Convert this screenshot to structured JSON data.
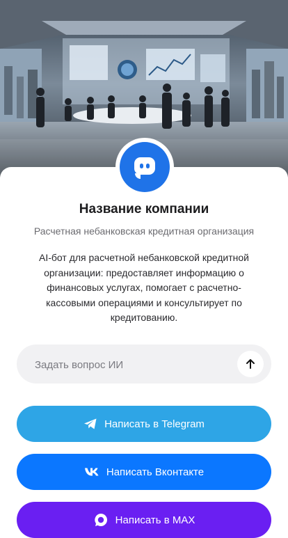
{
  "company": {
    "name": "Название компании",
    "subtitle": "Расчетная небанковская кредитная организация",
    "description": "AI-бот для расчетной небанковской кредитной организации: предоставляет информацию о финансовых услугах, помогает с расчетно-кассовыми операциями и консультирует по кредитованию."
  },
  "ask": {
    "placeholder": "Задать вопрос ИИ",
    "send_icon": "arrow-up-icon"
  },
  "buttons": {
    "telegram": {
      "label": "Написать в Telegram",
      "icon": "telegram-icon",
      "color": "#2ea5e6"
    },
    "vk": {
      "label": "Написать Вконтакте",
      "icon": "vk-icon",
      "color": "#0b77ff"
    },
    "max": {
      "label": "Написать в MAX",
      "icon": "max-icon",
      "color": "#6a1ff2"
    }
  },
  "colors": {
    "accent": "#1f73e8",
    "field_bg": "#f1f1f3"
  },
  "hero": {
    "image": "office-meeting-room-image",
    "avatar_icon": "chat-bot-icon"
  }
}
